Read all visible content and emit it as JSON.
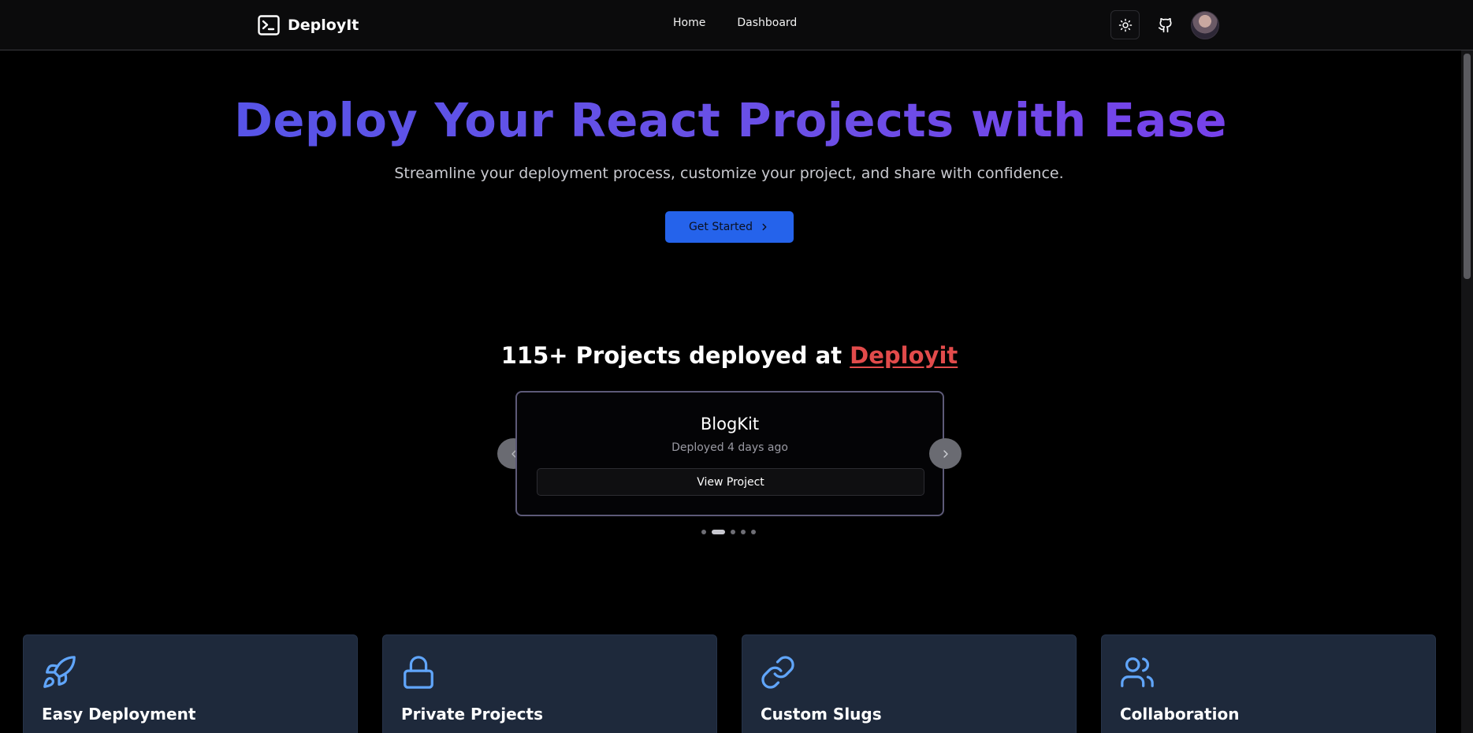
{
  "header": {
    "brand": "DeployIt",
    "nav": [
      "Home",
      "Dashboard"
    ],
    "icons": {
      "theme": "sun-icon",
      "github": "github-icon",
      "avatar": "avatar"
    }
  },
  "hero": {
    "title": "Deploy Your React Projects with Ease",
    "subtitle": "Streamline your deployment process, customize your project, and share with confidence.",
    "cta_label": "Get Started"
  },
  "showcase": {
    "title_prefix": "115+ Projects deployed at ",
    "title_accent": "Deployit",
    "project": {
      "name": "BlogKit",
      "meta": "Deployed 4 days ago",
      "button": "View Project"
    },
    "dots_total": 5,
    "active_dot": 1
  },
  "features": [
    {
      "title": "Easy Deployment",
      "icon": "rocket-icon"
    },
    {
      "title": "Private Projects",
      "icon": "lock-icon"
    },
    {
      "title": "Custom Slugs",
      "icon": "link-icon"
    },
    {
      "title": "Collaboration",
      "icon": "users-icon"
    }
  ],
  "colors": {
    "primary_button": "#2563eb",
    "accent_text": "#e24b4b",
    "feature_card_bg": "#1e293b",
    "feature_icon": "#60a5fa",
    "title_gradient_start": "#4f56e8",
    "title_gradient_end": "#7c3aed"
  }
}
